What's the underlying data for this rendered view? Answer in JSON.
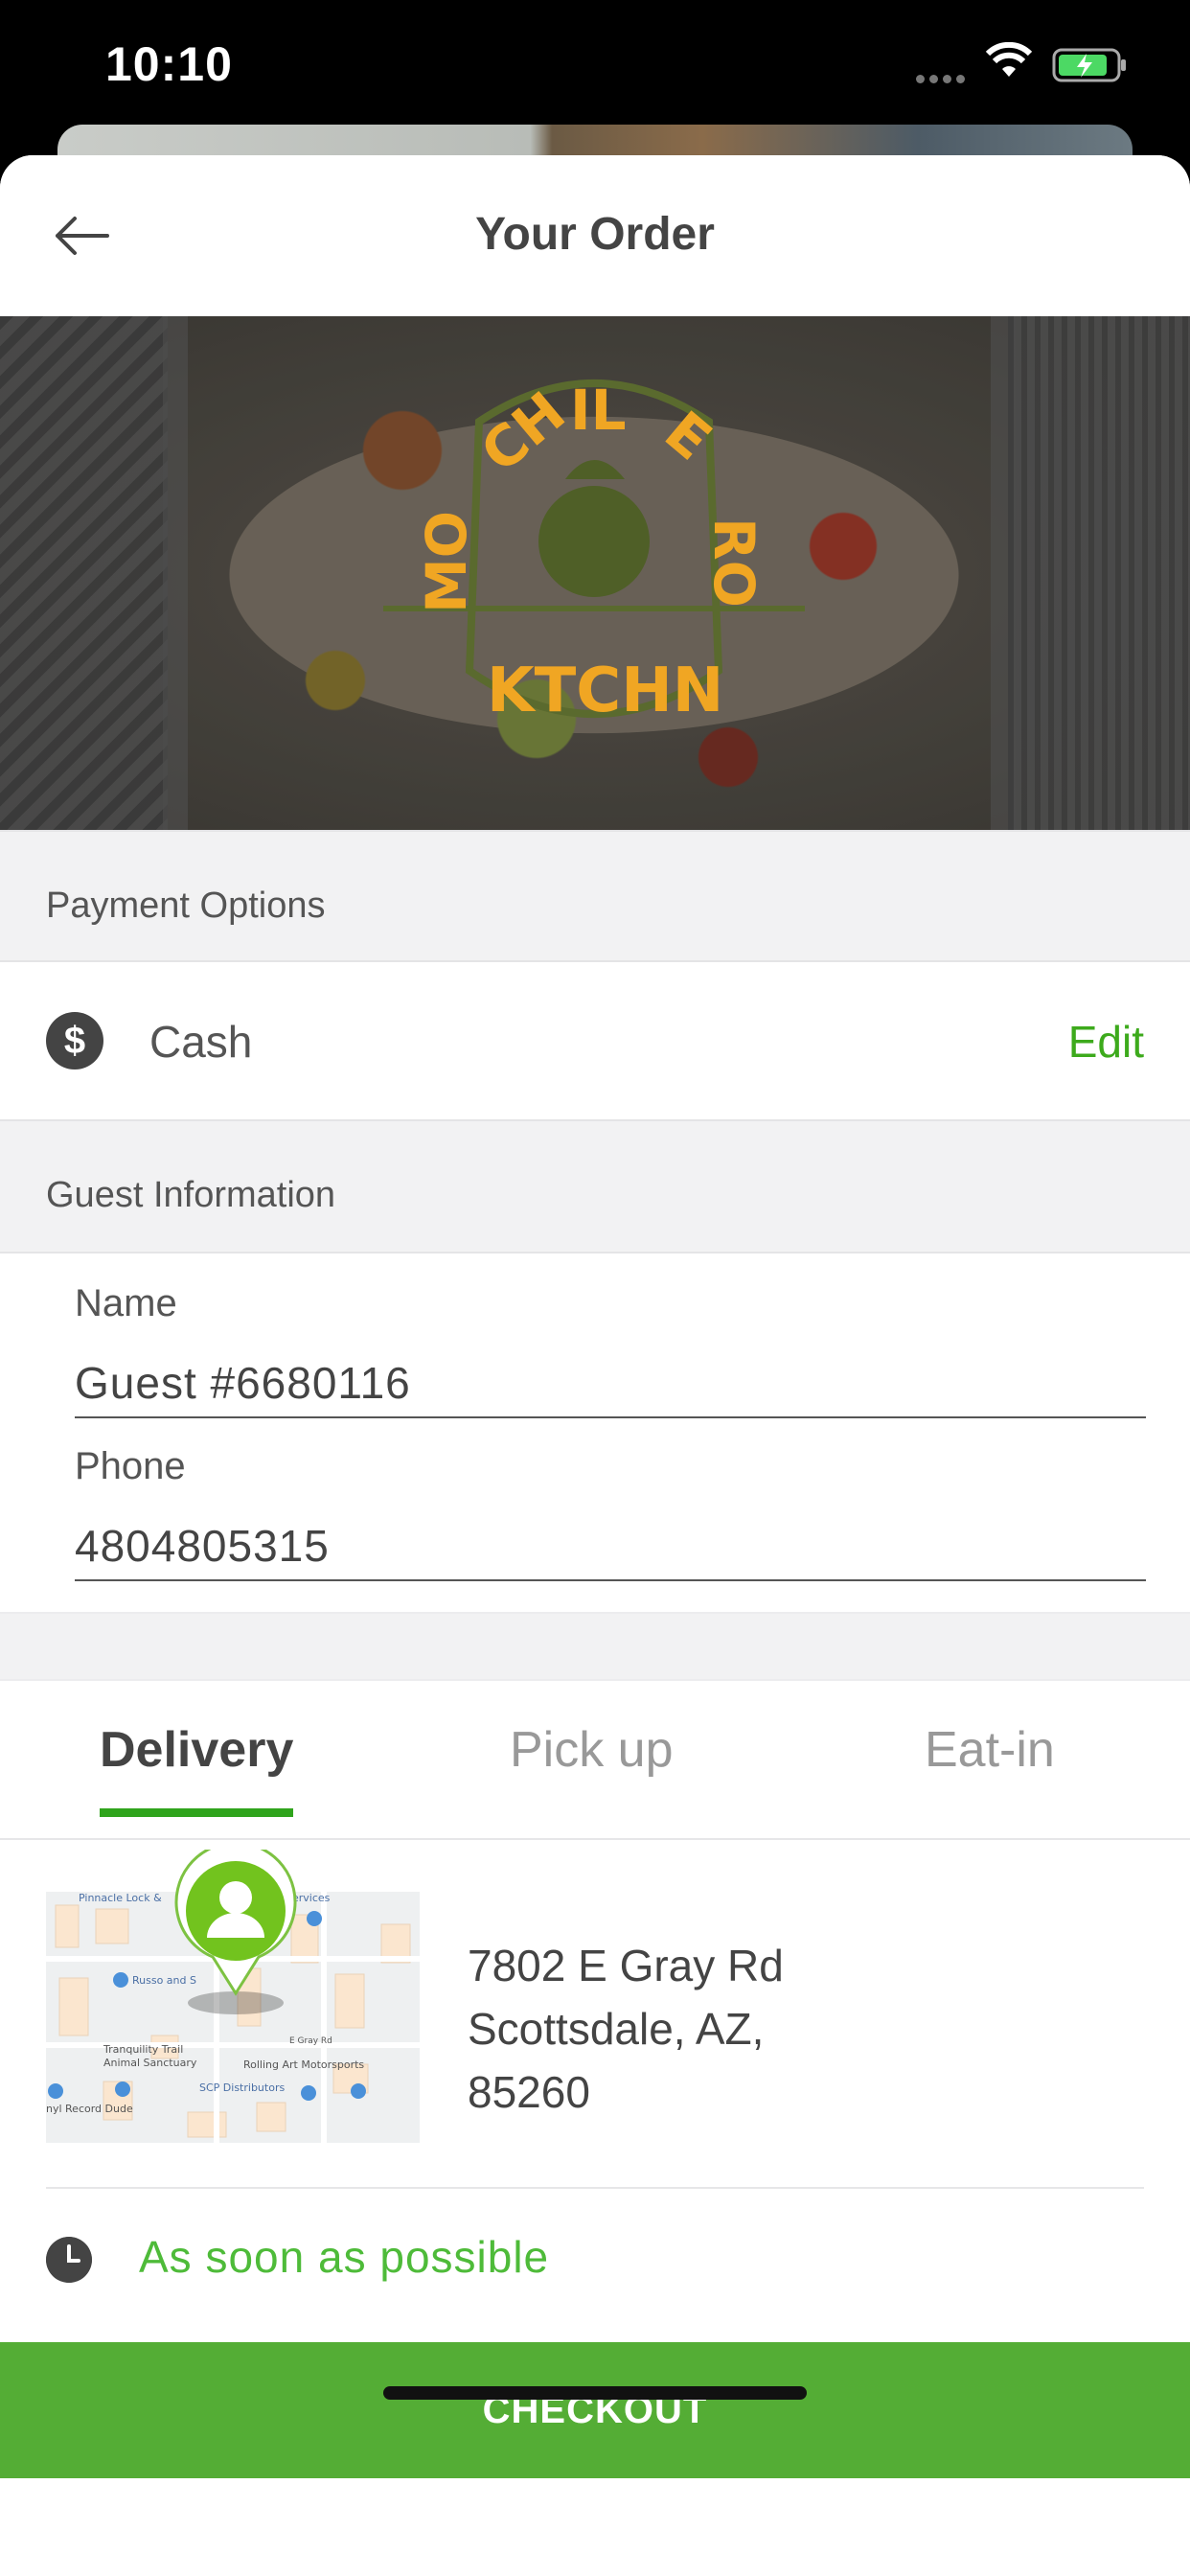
{
  "status_bar": {
    "time": "10:10"
  },
  "header": {
    "title": "Your Order"
  },
  "brand": {
    "logo_line1": "MOCHILERO",
    "logo_line2": "KTCHN"
  },
  "payment": {
    "section_title": "Payment Options",
    "method": "Cash",
    "edit_label": "Edit"
  },
  "guest": {
    "section_title": "Guest Information",
    "name_label": "Name",
    "name_value": "Guest #6680116",
    "phone_label": "Phone",
    "phone_value": "4804805315"
  },
  "order_type": {
    "tabs": [
      {
        "label": "Delivery",
        "active": true
      },
      {
        "label": "Pick up",
        "active": false
      },
      {
        "label": "Eat-in",
        "active": false
      }
    ]
  },
  "delivery": {
    "address_line1": "7802 E Gray Rd",
    "address_line2": "Scottsdale, AZ,",
    "address_line3": "85260",
    "map_labels": {
      "l1": "Pinnacle Lock &",
      "l2": "Services",
      "l3": "Russo and S",
      "l4": "Tranquility Trail",
      "l5": "Animal Sanctuary",
      "l6": "Rolling Art Motorsports",
      "l7": "SCP Distributors",
      "l8": "nyl Record Dude",
      "l9": "E Gray Rd"
    }
  },
  "timing": {
    "label": "As soon as possible"
  },
  "checkout": {
    "label": "CHECKOUT"
  },
  "colors": {
    "accent": "#54ad35",
    "active_tab": "#2fa41c",
    "edit": "#3daa1c",
    "time_text": "#4ebb39"
  },
  "icons": [
    "back-arrow-icon",
    "dollar-icon",
    "map-pin-icon",
    "clock-icon",
    "wifi-icon",
    "battery-icon"
  ]
}
